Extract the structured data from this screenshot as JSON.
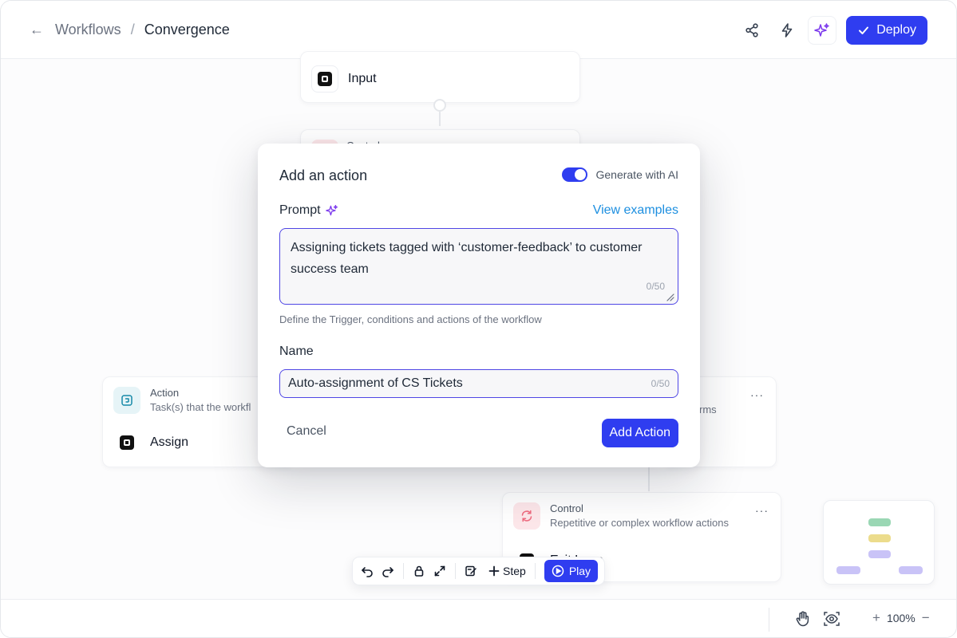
{
  "breadcrumb": {
    "parent": "Workflows",
    "separator": "/",
    "current": "Convergence"
  },
  "header": {
    "deploy_label": "Deploy"
  },
  "nodes": {
    "input": {
      "label": "Input"
    },
    "control_top": {
      "title": "Control"
    },
    "action": {
      "title": "Action",
      "subtitle": "Task(s) that the workfl",
      "item": "Assign"
    },
    "right_partial": {
      "subtitle": "rms"
    },
    "control_bottom": {
      "title": "Control",
      "subtitle": "Repetitive or complex workflow actions",
      "item": "Exit Loop"
    },
    "menu_glyph": "···"
  },
  "toolbar": {
    "step_label": "Step",
    "play_label": "Play"
  },
  "bottombar": {
    "zoom": "100%"
  },
  "modal": {
    "title": "Add an action",
    "toggle_label": "Generate with AI",
    "prompt_label": "Prompt",
    "view_examples": "View examples",
    "prompt_value": "Assigning tickets tagged with ‘customer-feedback’ to customer success team",
    "prompt_counter": "0/50",
    "helper_text": "Define the Trigger, conditions and actions of the workflow",
    "name_label": "Name",
    "name_value": "Auto-assignment of CS Tickets",
    "name_counter": "0/50",
    "cancel_label": "Cancel",
    "add_label": "Add Action"
  },
  "colors": {
    "primary": "#2f3df0",
    "accent_link": "#1d8fe0",
    "ai_sparkle": "#7c3aed",
    "minimap_green": "#9ad7b4",
    "minimap_yellow": "#ecdc8c",
    "minimap_purple": "#c9c3f7"
  }
}
